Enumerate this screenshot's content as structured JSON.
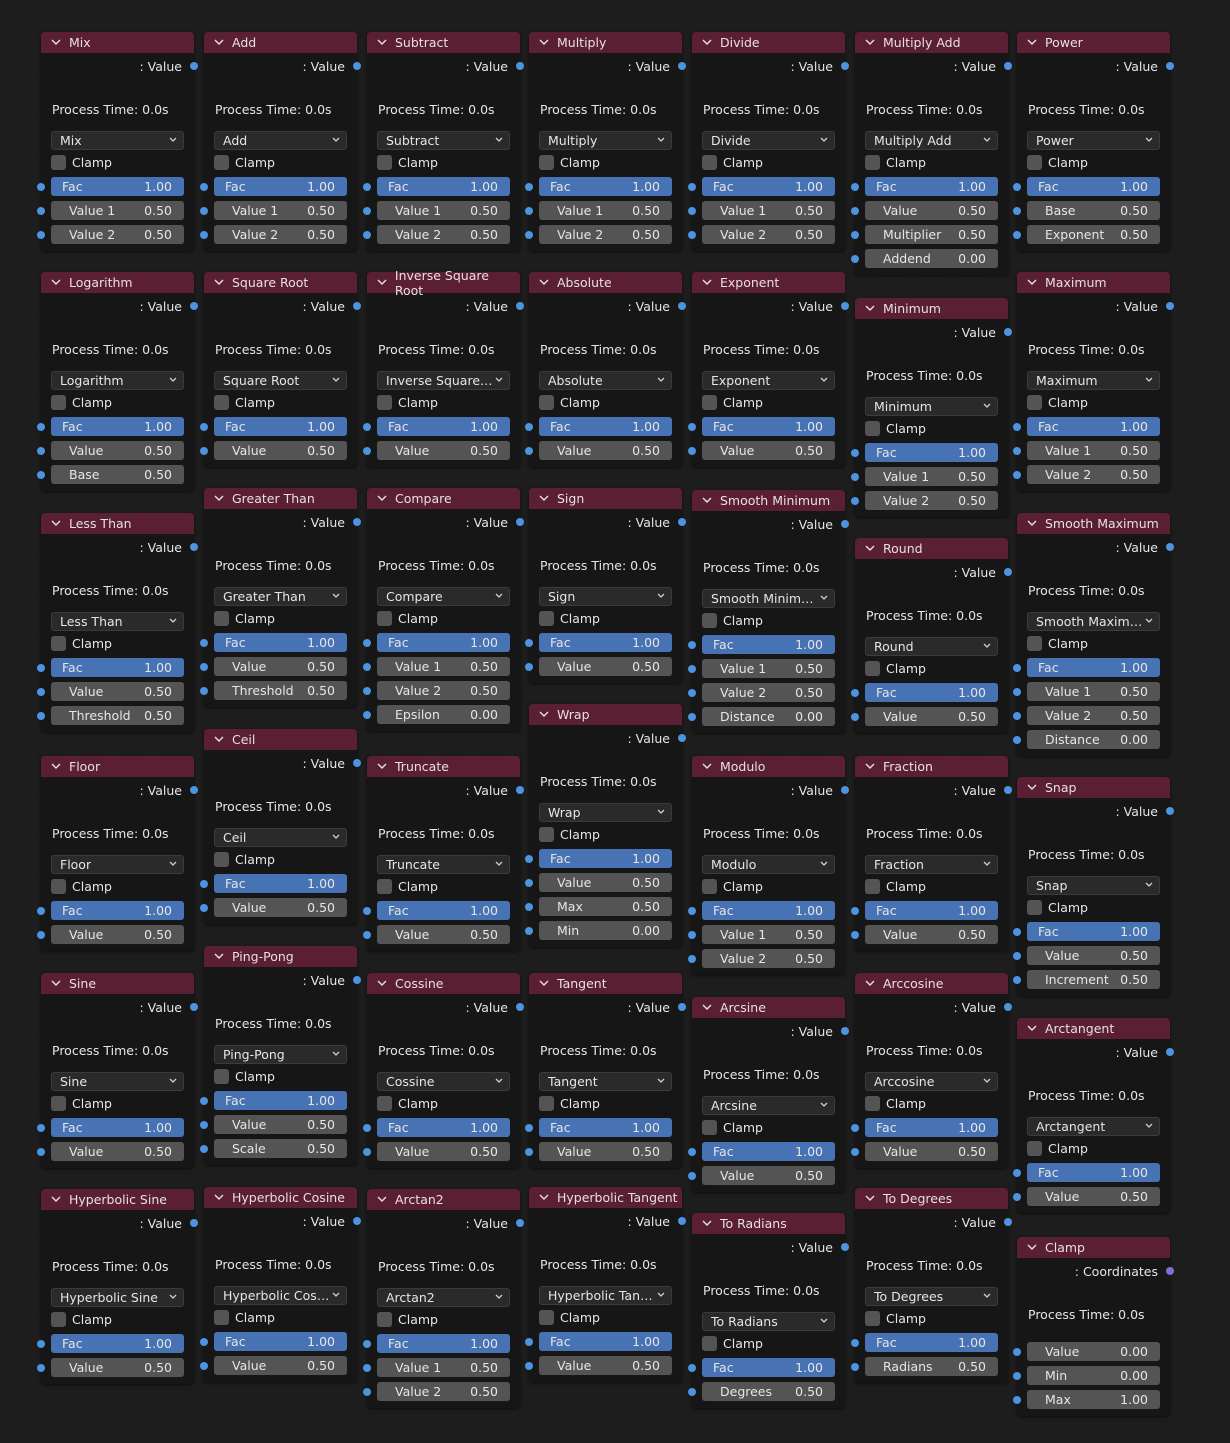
{
  "colors": {
    "background": "#1d1d1d",
    "node_body": "#161616",
    "node_header": "#5b1f33",
    "fac_field": "#4772b3",
    "value_field": "#545454",
    "socket_float": "#4c93e0",
    "socket_vector": "#7d6fd8"
  },
  "common": {
    "output_prefix": ": ",
    "clamp_label": "Clamp",
    "collapse_icon": "chevron-down-icon",
    "dropdown_icon": "chevron-down-icon"
  },
  "nodes": [
    {
      "id": "mix",
      "title": "Mix",
      "output": "Value",
      "process_time": "Process Time: 0.0s",
      "operation": "Mix",
      "clamp": false,
      "inputs": [
        {
          "label": "Fac",
          "value": "1.00"
        },
        {
          "label": "Value 1",
          "value": "0.50"
        },
        {
          "label": "Value 2",
          "value": "0.50"
        }
      ]
    },
    {
      "id": "add",
      "title": "Add",
      "output": "Value",
      "process_time": "Process Time: 0.0s",
      "operation": "Add",
      "clamp": false,
      "inputs": [
        {
          "label": "Fac",
          "value": "1.00"
        },
        {
          "label": "Value 1",
          "value": "0.50"
        },
        {
          "label": "Value 2",
          "value": "0.50"
        }
      ]
    },
    {
      "id": "subtract",
      "title": "Subtract",
      "output": "Value",
      "process_time": "Process Time: 0.0s",
      "operation": "Subtract",
      "clamp": false,
      "inputs": [
        {
          "label": "Fac",
          "value": "1.00"
        },
        {
          "label": "Value 1",
          "value": "0.50"
        },
        {
          "label": "Value 2",
          "value": "0.50"
        }
      ]
    },
    {
      "id": "multiply",
      "title": "Multiply",
      "output": "Value",
      "process_time": "Process Time: 0.0s",
      "operation": "Multiply",
      "clamp": false,
      "inputs": [
        {
          "label": "Fac",
          "value": "1.00"
        },
        {
          "label": "Value 1",
          "value": "0.50"
        },
        {
          "label": "Value 2",
          "value": "0.50"
        }
      ]
    },
    {
      "id": "divide",
      "title": "Divide",
      "output": "Value",
      "process_time": "Process Time: 0.0s",
      "operation": "Divide",
      "clamp": false,
      "inputs": [
        {
          "label": "Fac",
          "value": "1.00"
        },
        {
          "label": "Value 1",
          "value": "0.50"
        },
        {
          "label": "Value 2",
          "value": "0.50"
        }
      ]
    },
    {
      "id": "multiply-add",
      "title": "Multiply Add",
      "output": "Value",
      "process_time": "Process Time: 0.0s",
      "operation": "Multiply Add",
      "clamp": false,
      "inputs": [
        {
          "label": "Fac",
          "value": "1.00"
        },
        {
          "label": "Value",
          "value": "0.50"
        },
        {
          "label": "Multiplier",
          "value": "0.50"
        },
        {
          "label": "Addend",
          "value": "0.00"
        }
      ]
    },
    {
      "id": "power",
      "title": "Power",
      "output": "Value",
      "process_time": "Process Time: 0.0s",
      "operation": "Power",
      "clamp": false,
      "inputs": [
        {
          "label": "Fac",
          "value": "1.00"
        },
        {
          "label": "Base",
          "value": "0.50"
        },
        {
          "label": "Exponent",
          "value": "0.50"
        }
      ]
    },
    {
      "id": "logarithm",
      "title": "Logarithm",
      "output": "Value",
      "process_time": "Process Time: 0.0s",
      "operation": "Logarithm",
      "clamp": false,
      "inputs": [
        {
          "label": "Fac",
          "value": "1.00"
        },
        {
          "label": "Value",
          "value": "0.50"
        },
        {
          "label": "Base",
          "value": "0.50"
        }
      ]
    },
    {
      "id": "square-root",
      "title": "Square Root",
      "output": "Value",
      "process_time": "Process Time: 0.0s",
      "operation": "Square Root",
      "clamp": false,
      "inputs": [
        {
          "label": "Fac",
          "value": "1.00"
        },
        {
          "label": "Value",
          "value": "0.50"
        }
      ]
    },
    {
      "id": "inverse-square-root",
      "title": "Inverse Square Root",
      "output": "Value",
      "process_time": "Process Time: 0.0s",
      "operation": "Inverse Square R...",
      "clamp": false,
      "inputs": [
        {
          "label": "Fac",
          "value": "1.00"
        },
        {
          "label": "Value",
          "value": "0.50"
        }
      ]
    },
    {
      "id": "absolute",
      "title": "Absolute",
      "output": "Value",
      "process_time": "Process Time: 0.0s",
      "operation": "Absolute",
      "clamp": false,
      "inputs": [
        {
          "label": "Fac",
          "value": "1.00"
        },
        {
          "label": "Value",
          "value": "0.50"
        }
      ]
    },
    {
      "id": "exponent",
      "title": "Exponent",
      "output": "Value",
      "process_time": "Process Time: 0.0s",
      "operation": "Exponent",
      "clamp": false,
      "inputs": [
        {
          "label": "Fac",
          "value": "1.00"
        },
        {
          "label": "Value",
          "value": "0.50"
        }
      ]
    },
    {
      "id": "minimum",
      "title": "Minimum",
      "output": "Value",
      "process_time": "Process Time: 0.0s",
      "operation": "Minimum",
      "clamp": false,
      "inputs": [
        {
          "label": "Fac",
          "value": "1.00"
        },
        {
          "label": "Value 1",
          "value": "0.50"
        },
        {
          "label": "Value 2",
          "value": "0.50"
        }
      ]
    },
    {
      "id": "maximum",
      "title": "Maximum",
      "output": "Value",
      "process_time": "Process Time: 0.0s",
      "operation": "Maximum",
      "clamp": false,
      "inputs": [
        {
          "label": "Fac",
          "value": "1.00"
        },
        {
          "label": "Value 1",
          "value": "0.50"
        },
        {
          "label": "Value 2",
          "value": "0.50"
        }
      ]
    },
    {
      "id": "less-than",
      "title": "Less Than",
      "output": "Value",
      "process_time": "Process Time: 0.0s",
      "operation": "Less Than",
      "clamp": false,
      "inputs": [
        {
          "label": "Fac",
          "value": "1.00"
        },
        {
          "label": "Value",
          "value": "0.50"
        },
        {
          "label": "Threshold",
          "value": "0.50"
        }
      ]
    },
    {
      "id": "greater-than",
      "title": "Greater Than",
      "output": "Value",
      "process_time": "Process Time: 0.0s",
      "operation": "Greater Than",
      "clamp": false,
      "inputs": [
        {
          "label": "Fac",
          "value": "1.00"
        },
        {
          "label": "Value",
          "value": "0.50"
        },
        {
          "label": "Threshold",
          "value": "0.50"
        }
      ]
    },
    {
      "id": "compare",
      "title": "Compare",
      "output": "Value",
      "process_time": "Process Time: 0.0s",
      "operation": "Compare",
      "clamp": false,
      "inputs": [
        {
          "label": "Fac",
          "value": "1.00"
        },
        {
          "label": "Value 1",
          "value": "0.50"
        },
        {
          "label": "Value 2",
          "value": "0.50"
        },
        {
          "label": "Epsilon",
          "value": "0.00"
        }
      ]
    },
    {
      "id": "sign",
      "title": "Sign",
      "output": "Value",
      "process_time": "Process Time: 0.0s",
      "operation": "Sign",
      "clamp": false,
      "inputs": [
        {
          "label": "Fac",
          "value": "1.00"
        },
        {
          "label": "Value",
          "value": "0.50"
        }
      ]
    },
    {
      "id": "smooth-minimum",
      "title": "Smooth Minimum",
      "output": "Value",
      "process_time": "Process Time: 0.0s",
      "operation": "Smooth Minimum",
      "clamp": false,
      "inputs": [
        {
          "label": "Fac",
          "value": "1.00"
        },
        {
          "label": "Value 1",
          "value": "0.50"
        },
        {
          "label": "Value 2",
          "value": "0.50"
        },
        {
          "label": "Distance",
          "value": "0.00"
        }
      ]
    },
    {
      "id": "round",
      "title": "Round",
      "output": "Value",
      "process_time": "Process Time: 0.0s",
      "operation": "Round",
      "clamp": false,
      "inputs": [
        {
          "label": "Fac",
          "value": "1.00"
        },
        {
          "label": "Value",
          "value": "0.50"
        }
      ]
    },
    {
      "id": "smooth-maximum",
      "title": "Smooth Maximum",
      "output": "Value",
      "process_time": "Process Time: 0.0s",
      "operation": "Smooth Maximum",
      "clamp": false,
      "inputs": [
        {
          "label": "Fac",
          "value": "1.00"
        },
        {
          "label": "Value 1",
          "value": "0.50"
        },
        {
          "label": "Value 2",
          "value": "0.50"
        },
        {
          "label": "Distance",
          "value": "0.00"
        }
      ]
    },
    {
      "id": "floor",
      "title": "Floor",
      "output": "Value",
      "process_time": "Process Time: 0.0s",
      "operation": "Floor",
      "clamp": false,
      "inputs": [
        {
          "label": "Fac",
          "value": "1.00"
        },
        {
          "label": "Value",
          "value": "0.50"
        }
      ]
    },
    {
      "id": "ceil",
      "title": "Ceil",
      "output": "Value",
      "process_time": "Process Time: 0.0s",
      "operation": "Ceil",
      "clamp": false,
      "inputs": [
        {
          "label": "Fac",
          "value": "1.00"
        },
        {
          "label": "Value",
          "value": "0.50"
        }
      ]
    },
    {
      "id": "truncate",
      "title": "Truncate",
      "output": "Value",
      "process_time": "Process Time: 0.0s",
      "operation": "Truncate",
      "clamp": false,
      "inputs": [
        {
          "label": "Fac",
          "value": "1.00"
        },
        {
          "label": "Value",
          "value": "0.50"
        }
      ]
    },
    {
      "id": "wrap",
      "title": "Wrap",
      "output": "Value",
      "process_time": "Process Time: 0.0s",
      "operation": "Wrap",
      "clamp": false,
      "inputs": [
        {
          "label": "Fac",
          "value": "1.00"
        },
        {
          "label": "Value",
          "value": "0.50"
        },
        {
          "label": "Max",
          "value": "0.50"
        },
        {
          "label": "Min",
          "value": "0.00"
        }
      ]
    },
    {
      "id": "modulo",
      "title": "Modulo",
      "output": "Value",
      "process_time": "Process Time: 0.0s",
      "operation": "Modulo",
      "clamp": false,
      "inputs": [
        {
          "label": "Fac",
          "value": "1.00"
        },
        {
          "label": "Value 1",
          "value": "0.50"
        },
        {
          "label": "Value 2",
          "value": "0.50"
        }
      ]
    },
    {
      "id": "fraction",
      "title": "Fraction",
      "output": "Value",
      "process_time": "Process Time: 0.0s",
      "operation": "Fraction",
      "clamp": false,
      "inputs": [
        {
          "label": "Fac",
          "value": "1.00"
        },
        {
          "label": "Value",
          "value": "0.50"
        }
      ]
    },
    {
      "id": "snap",
      "title": "Snap",
      "output": "Value",
      "process_time": "Process Time: 0.0s",
      "operation": "Snap",
      "clamp": false,
      "inputs": [
        {
          "label": "Fac",
          "value": "1.00"
        },
        {
          "label": "Value",
          "value": "0.50"
        },
        {
          "label": "Increment",
          "value": "0.50"
        }
      ]
    },
    {
      "id": "sine",
      "title": "Sine",
      "output": "Value",
      "process_time": "Process Time: 0.0s",
      "operation": "Sine",
      "clamp": false,
      "inputs": [
        {
          "label": "Fac",
          "value": "1.00"
        },
        {
          "label": "Value",
          "value": "0.50"
        }
      ]
    },
    {
      "id": "ping-pong",
      "title": "Ping-Pong",
      "output": "Value",
      "process_time": "Process Time: 0.0s",
      "operation": "Ping-Pong",
      "clamp": false,
      "inputs": [
        {
          "label": "Fac",
          "value": "1.00"
        },
        {
          "label": "Value",
          "value": "0.50"
        },
        {
          "label": "Scale",
          "value": "0.50"
        }
      ]
    },
    {
      "id": "cossine",
      "title": "Cossine",
      "output": "Value",
      "process_time": "Process Time: 0.0s",
      "operation": "Cossine",
      "clamp": false,
      "inputs": [
        {
          "label": "Fac",
          "value": "1.00"
        },
        {
          "label": "Value",
          "value": "0.50"
        }
      ]
    },
    {
      "id": "tangent",
      "title": "Tangent",
      "output": "Value",
      "process_time": "Process Time: 0.0s",
      "operation": "Tangent",
      "clamp": false,
      "inputs": [
        {
          "label": "Fac",
          "value": "1.00"
        },
        {
          "label": "Value",
          "value": "0.50"
        }
      ]
    },
    {
      "id": "arcsine",
      "title": "Arcsine",
      "output": "Value",
      "process_time": "Process Time: 0.0s",
      "operation": "Arcsine",
      "clamp": false,
      "inputs": [
        {
          "label": "Fac",
          "value": "1.00"
        },
        {
          "label": "Value",
          "value": "0.50"
        }
      ]
    },
    {
      "id": "arccosine",
      "title": "Arccosine",
      "output": "Value",
      "process_time": "Process Time: 0.0s",
      "operation": "Arccosine",
      "clamp": false,
      "inputs": [
        {
          "label": "Fac",
          "value": "1.00"
        },
        {
          "label": "Value",
          "value": "0.50"
        }
      ]
    },
    {
      "id": "arctangent",
      "title": "Arctangent",
      "output": "Value",
      "process_time": "Process Time: 0.0s",
      "operation": "Arctangent",
      "clamp": false,
      "inputs": [
        {
          "label": "Fac",
          "value": "1.00"
        },
        {
          "label": "Value",
          "value": "0.50"
        }
      ]
    },
    {
      "id": "hyperbolic-sine",
      "title": "Hyperbolic Sine",
      "output": "Value",
      "process_time": "Process Time: 0.0s",
      "operation": "Hyperbolic Sine",
      "clamp": false,
      "inputs": [
        {
          "label": "Fac",
          "value": "1.00"
        },
        {
          "label": "Value",
          "value": "0.50"
        }
      ]
    },
    {
      "id": "hyperbolic-cosine",
      "title": "Hyperbolic Cosine",
      "output": "Value",
      "process_time": "Process Time: 0.0s",
      "operation": "Hyperbolic Cosine",
      "clamp": false,
      "inputs": [
        {
          "label": "Fac",
          "value": "1.00"
        },
        {
          "label": "Value",
          "value": "0.50"
        }
      ]
    },
    {
      "id": "arctan2",
      "title": "Arctan2",
      "output": "Value",
      "process_time": "Process Time: 0.0s",
      "operation": "Arctan2",
      "clamp": false,
      "inputs": [
        {
          "label": "Fac",
          "value": "1.00"
        },
        {
          "label": "Value 1",
          "value": "0.50"
        },
        {
          "label": "Value 2",
          "value": "0.50"
        }
      ]
    },
    {
      "id": "hyperbolic-tangent",
      "title": "Hyperbolic Tangent",
      "output": "Value",
      "process_time": "Process Time: 0.0s",
      "operation": "Hyperbolic Tange...",
      "clamp": false,
      "inputs": [
        {
          "label": "Fac",
          "value": "1.00"
        },
        {
          "label": "Value",
          "value": "0.50"
        }
      ]
    },
    {
      "id": "to-radians",
      "title": "To Radians",
      "output": "Value",
      "process_time": "Process Time: 0.0s",
      "operation": "To Radians",
      "clamp": false,
      "inputs": [
        {
          "label": "Fac",
          "value": "1.00"
        },
        {
          "label": "Degrees",
          "value": "0.50"
        }
      ]
    },
    {
      "id": "to-degrees",
      "title": "To Degrees",
      "output": "Value",
      "process_time": "Process Time: 0.0s",
      "operation": "To Degrees",
      "clamp": false,
      "inputs": [
        {
          "label": "Fac",
          "value": "1.00"
        },
        {
          "label": "Radians",
          "value": "0.50"
        }
      ]
    },
    {
      "id": "clamp",
      "title": "Clamp",
      "output": "Coordinates",
      "output_socket": "vector",
      "process_time": "Process Time: 0.0s",
      "operation": null,
      "clamp": null,
      "inputs": [
        {
          "label": "Value",
          "value": "0.00"
        },
        {
          "label": "Min",
          "value": "0.00"
        },
        {
          "label": "Max",
          "value": "1.00"
        }
      ]
    }
  ]
}
